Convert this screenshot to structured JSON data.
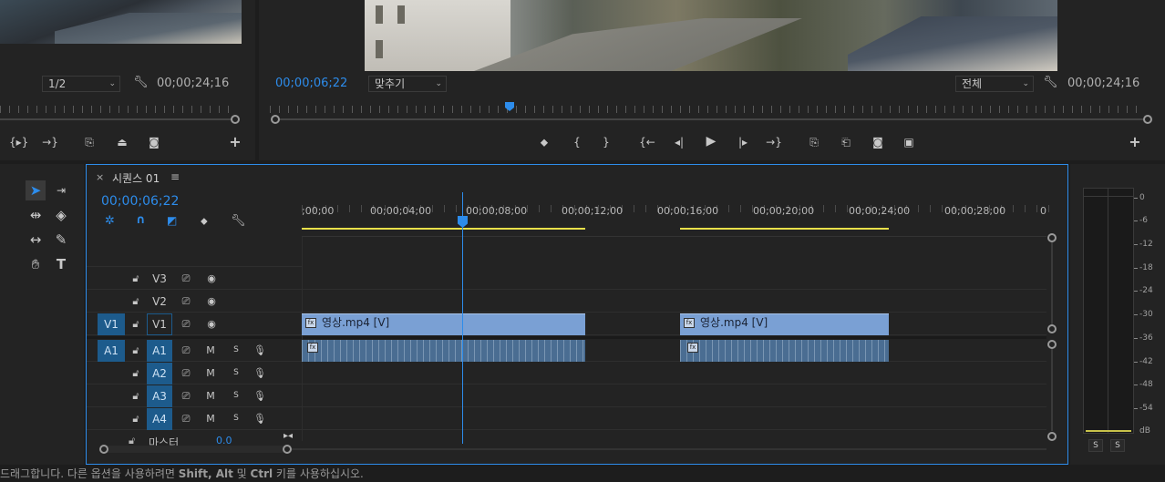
{
  "source_monitor": {
    "zoom_value": "1/2",
    "wrench_icon": "wrench-icon",
    "duration": "00;00;24;16",
    "buttons": [
      "mark-in-out-icon",
      "go-to-in-icon",
      "insert-icon",
      "overwrite-icon",
      "camera-icon",
      "add-icon"
    ]
  },
  "program_monitor": {
    "timecode": "00;00;06;22",
    "fit_value": "맞추기",
    "quality_value": "전체",
    "duration": "00;00;24;16",
    "add_label": "+"
  },
  "tools": {
    "selection": "selection-tool-icon",
    "track_select": "track-select-forward-icon",
    "ripple": "ripple-edit-icon",
    "razor": "razor-icon",
    "slip": "slip-icon",
    "pen": "pen-icon",
    "hand": "hand-icon",
    "type_label": "T"
  },
  "timeline": {
    "close_label": "×",
    "tab_title": "시퀀스 01",
    "menu_label": "≡",
    "timecode": "00;00;06;22",
    "ruler_labels": [
      ";00;00",
      "00;00;04;00",
      "00;00;08;00",
      "00;00;12;00",
      "00;00;16;00",
      "00;00;20;00",
      "00;00;24;00",
      "00;00;28;00",
      "0"
    ],
    "video_tracks": [
      {
        "source": "",
        "name": "V3"
      },
      {
        "source": "",
        "name": "V2"
      },
      {
        "source": "V1",
        "name": "V1"
      }
    ],
    "audio_tracks": [
      {
        "source": "A1",
        "name": "A1"
      },
      {
        "source": "",
        "name": "A2"
      },
      {
        "source": "",
        "name": "A3"
      },
      {
        "source": "",
        "name": "A4"
      }
    ],
    "mute_label": "M",
    "solo_label": "S",
    "master_label": "마스터",
    "master_value": "0.0",
    "clips": [
      {
        "label": "영상.mp4 [V]"
      },
      {
        "label": "영상.mp4 [V]"
      }
    ]
  },
  "meter": {
    "db_labels": [
      "0",
      "-6",
      "-12",
      "-18",
      "-24",
      "-30",
      "-36",
      "-42",
      "-48",
      "-54",
      "dB"
    ],
    "solo_left": "S",
    "solo_right": "S"
  },
  "status_bar": {
    "text_before": "드래그합니다. 다른 옵션을 사용하려면 ",
    "keys": "Shift, Alt",
    "text_middle": " 및 ",
    "key_ctrl": "Ctrl",
    "text_after": " 키를 사용하십시오."
  },
  "colors": {
    "accent": "#2d8ceb",
    "video_clip": "#7aa0d4",
    "audio_clip": "#4a6d92",
    "work_area": "#e8e04a"
  }
}
